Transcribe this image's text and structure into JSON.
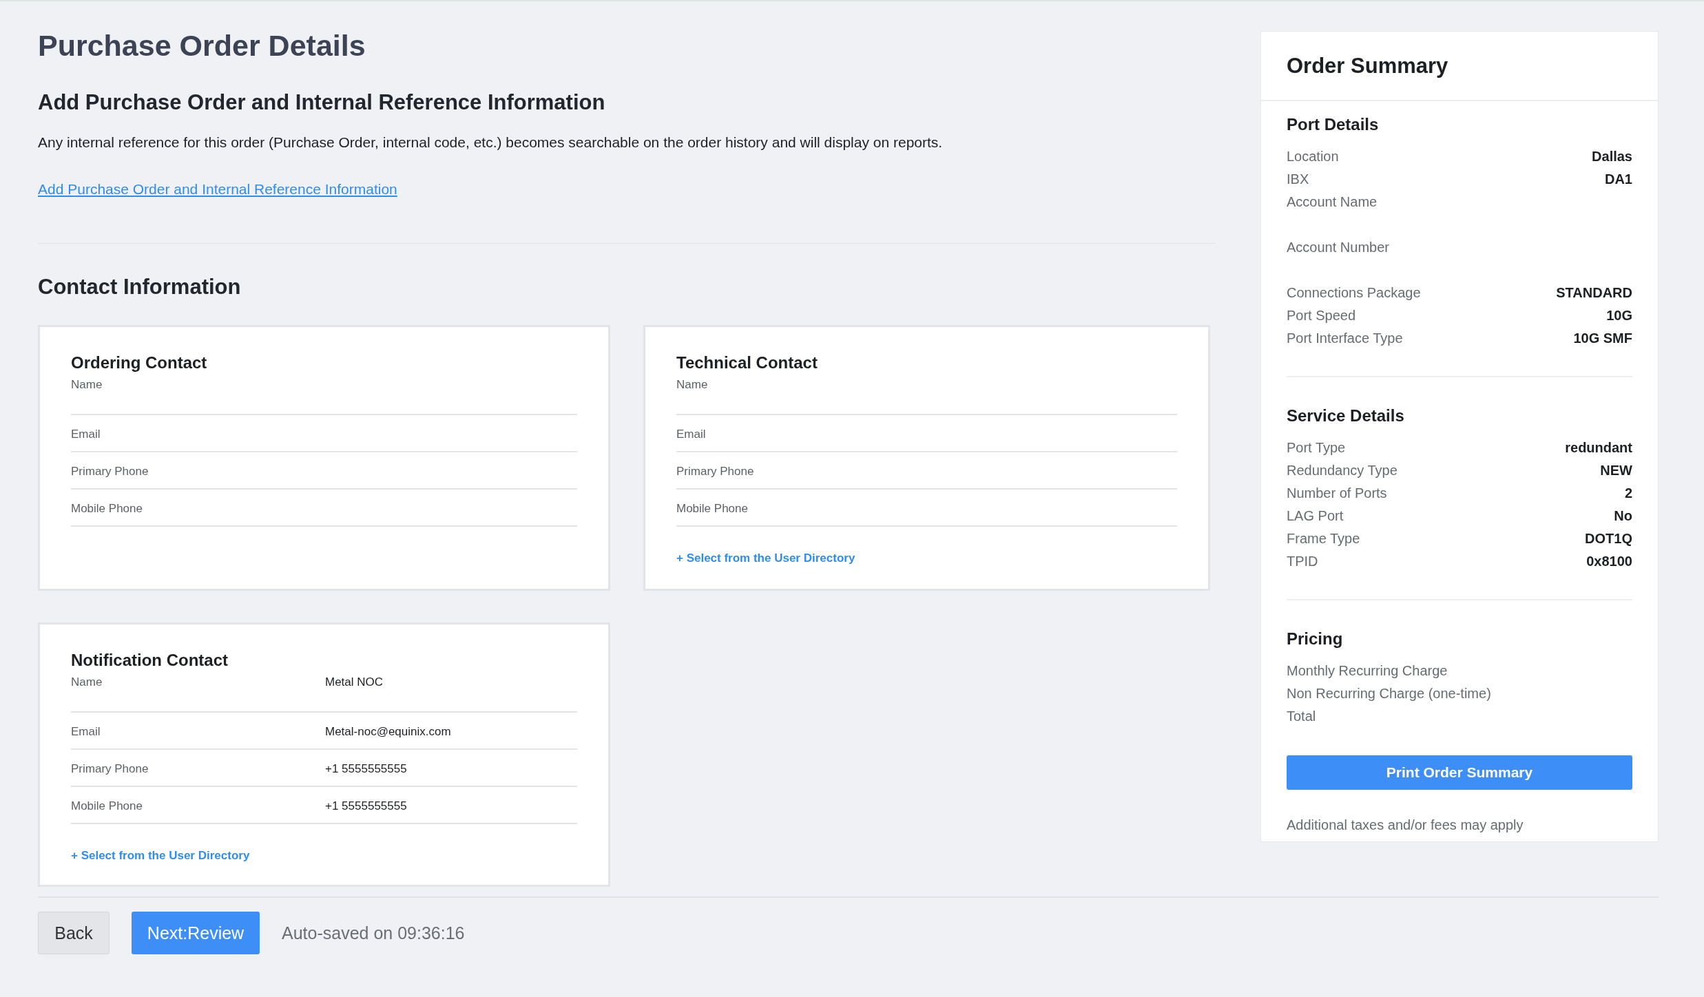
{
  "page": {
    "title": "Purchase Order Details"
  },
  "reference": {
    "heading": "Add Purchase Order and Internal Reference Information",
    "description": "Any internal reference for this order (Purchase Order, internal code, etc.) becomes searchable on the order history and will display on reports.",
    "link": "Add Purchase Order and Internal Reference Information"
  },
  "contact_information": {
    "heading": "Contact Information",
    "cards": [
      {
        "title": "Ordering Contact",
        "fields": [
          {
            "label": "Name"
          },
          {
            "label": "Email"
          },
          {
            "label": "Primary Phone"
          },
          {
            "label": "Mobile Phone"
          }
        ]
      },
      {
        "title": "Technical Contact",
        "fields": [
          {
            "label": "Name"
          },
          {
            "label": "Email"
          },
          {
            "label": "Primary Phone"
          },
          {
            "label": "Mobile Phone"
          }
        ],
        "link": "+ Select from the User Directory"
      },
      {
        "title": "Notification Contact",
        "fields": [
          {
            "label": "Name",
            "value": "Metal NOC"
          },
          {
            "label": "Email",
            "value": "Metal-noc@equinix.com"
          },
          {
            "label": "Primary Phone",
            "value": "+1 5555555555"
          },
          {
            "label": "Mobile Phone",
            "value": "+1 5555555555"
          }
        ],
        "link": "+ Select from the User Directory"
      }
    ]
  },
  "order_summary": {
    "title": "Order Summary",
    "sections": [
      {
        "title": "Port Details",
        "rows": [
          {
            "label": "Location",
            "value": "Dallas"
          },
          {
            "label": "IBX",
            "value": "DA1"
          },
          {
            "label": "Account Name"
          },
          {
            "label": "Account Number"
          },
          {
            "label": "Connections Package",
            "value": "STANDARD"
          },
          {
            "label": "Port Speed",
            "value": "10G"
          },
          {
            "label": "Port Interface Type",
            "value": "10G SMF"
          }
        ]
      },
      {
        "title": "Service Details",
        "rows": [
          {
            "label": "Port Type",
            "value": "redundant"
          },
          {
            "label": "Redundancy Type",
            "value": "NEW"
          },
          {
            "label": "Number of Ports",
            "value": "2"
          },
          {
            "label": "LAG Port",
            "value": "No"
          },
          {
            "label": "Frame Type",
            "value": "DOT1Q"
          },
          {
            "label": "TPID",
            "value": "0x8100"
          }
        ]
      },
      {
        "title": "Pricing",
        "rows": [
          {
            "label": "Monthly Recurring Charge"
          },
          {
            "label": "Non Recurring Charge (one-time)"
          },
          {
            "label": "Total"
          }
        ]
      }
    ],
    "button": "Print Order Summary",
    "note": "Additional taxes and/or fees may apply"
  },
  "footer": {
    "back": "Back",
    "next": "Next:Review",
    "status": "Auto-saved on 09:36:16"
  }
}
